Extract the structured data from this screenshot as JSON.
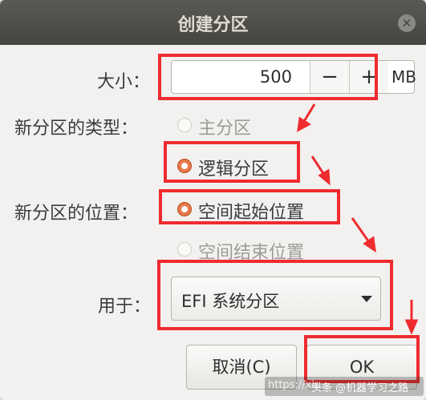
{
  "window": {
    "title": "创建分区",
    "close_icon": "close-icon"
  },
  "size": {
    "label": "大小：",
    "value": "500",
    "minus": "−",
    "plus": "+",
    "unit": "MB"
  },
  "type": {
    "label": "新分区的类型：",
    "options": [
      {
        "label": "主分区",
        "checked": false,
        "disabled": true
      },
      {
        "label": "逻辑分区",
        "checked": true,
        "disabled": false
      }
    ]
  },
  "location": {
    "label": "新分区的位置：",
    "options": [
      {
        "label": "空间起始位置",
        "checked": true,
        "disabled": false
      },
      {
        "label": "空间结束位置",
        "checked": false,
        "disabled": true
      }
    ]
  },
  "use_as": {
    "label": "用于：",
    "selected": "EFI 系统分区"
  },
  "buttons": {
    "cancel": "取消(C)",
    "ok": "OK"
  },
  "watermark": {
    "url": "https://xiu",
    "text": "头条 @机器学习之路"
  },
  "colors": {
    "titlebar": "#4f4e49",
    "accent": "#e8784a",
    "highlight": "#ef2b2f"
  }
}
